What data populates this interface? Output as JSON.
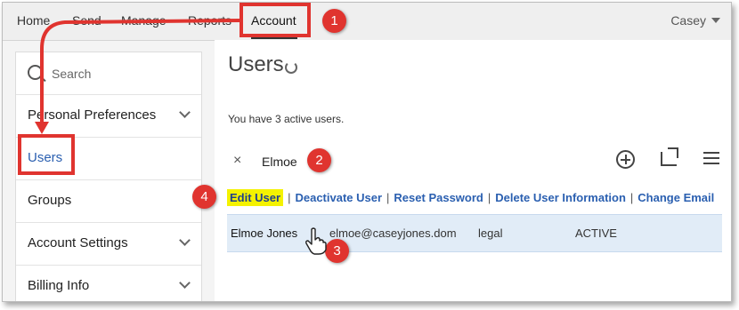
{
  "nav": {
    "items": [
      "Home",
      "Send",
      "Manage",
      "Reports",
      "Account"
    ],
    "active": "Account",
    "user": "Casey"
  },
  "sidebar": {
    "search_placeholder": "Search",
    "items": [
      {
        "label": "Personal Preferences",
        "expandable": true
      },
      {
        "label": "Users",
        "active": true
      },
      {
        "label": "Groups"
      },
      {
        "label": "Account Settings",
        "expandable": true
      },
      {
        "label": "Billing Info",
        "expandable": true
      }
    ]
  },
  "main": {
    "title": "Users",
    "active_count": "You have 3 active users.",
    "filter": {
      "clear": "×",
      "value": "Elmoe"
    },
    "actions": [
      "Edit User",
      "Deactivate User",
      "Reset Password",
      "Delete User Information",
      "Change Email"
    ],
    "actions_sep": "|",
    "user_row": {
      "name": "Elmoe Jones",
      "email": "elmoe@caseyjones.dom",
      "group": "legal",
      "status": "ACTIVE"
    }
  },
  "callouts": [
    "1",
    "2",
    "3",
    "4"
  ],
  "colors": {
    "accent": "#e0342f",
    "link": "#2a5fb0",
    "highlight": "#f4f200",
    "selected_row": "#e1ecf7"
  }
}
